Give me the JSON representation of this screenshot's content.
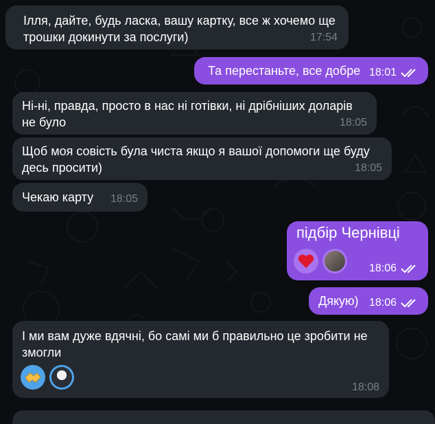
{
  "colors": {
    "background": "#0b0d10",
    "incoming_bubble": "#24292f",
    "outgoing_bubble": "#8a4fe0",
    "incoming_time": "#7a8088"
  },
  "messages": [
    {
      "direction": "in",
      "lines": [
        "Ілля, дайте, будь ласка, вашу картку, все ж хочемо ще",
        "трошки докинути за послуги)"
      ],
      "time": "17:54"
    },
    {
      "direction": "out",
      "text": "Та перестаньте, все добре",
      "time": "18:01",
      "status": "read"
    },
    {
      "direction": "in",
      "lines": [
        "Ні-ні, правда, просто в нас ні готівки, ні дрібніших доларів",
        "не було"
      ],
      "time": "18:05"
    },
    {
      "direction": "in",
      "lines": [
        "Щоб моя совість була чиста якщо я вашої допомоги ще буду",
        "десь просити)"
      ],
      "time": "18:05"
    },
    {
      "direction": "in",
      "text": "Чекаю карту",
      "time": "18:05"
    },
    {
      "direction": "out",
      "overlay_text": "підбір Чернівці",
      "reaction": "red-heart",
      "time": "18:06",
      "status": "read"
    },
    {
      "direction": "out",
      "text": "Дякую)",
      "time": "18:06",
      "status": "read"
    },
    {
      "direction": "in",
      "lines": [
        "І ми вам дуже вдячні, бо самі ми б правильно це зробити не",
        "змогли"
      ],
      "reaction": "handshake",
      "time": "18:08"
    }
  ]
}
